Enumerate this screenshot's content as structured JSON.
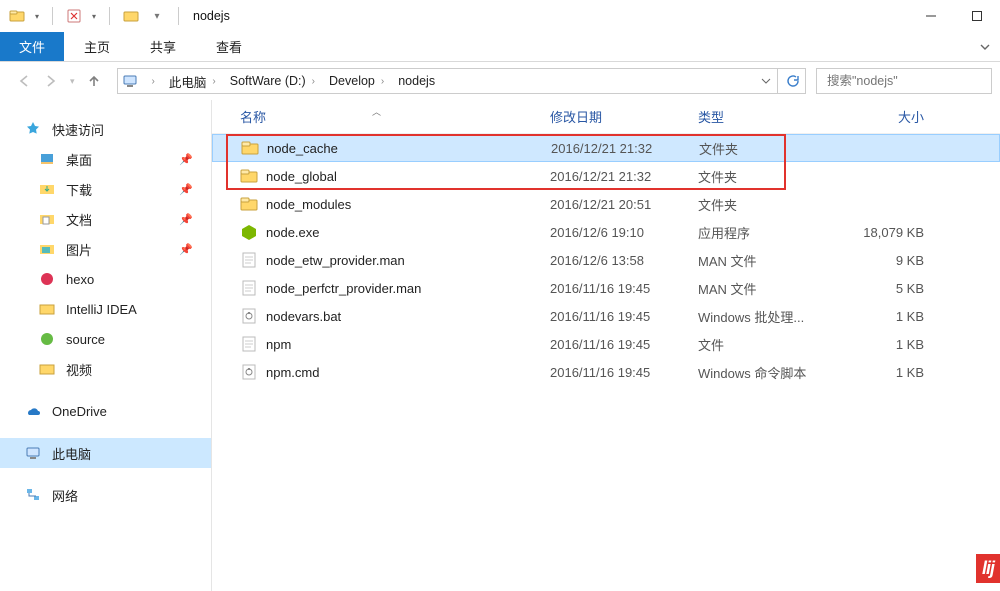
{
  "window": {
    "title": "nodejs"
  },
  "titlebar_qat": {
    "icon1": "folder-icon",
    "icon2": "props-icon"
  },
  "ribbon": {
    "file": "文件",
    "tabs": [
      "主页",
      "共享",
      "查看"
    ]
  },
  "breadcrumbs": [
    "此电脑",
    "SoftWare (D:)",
    "Develop",
    "nodejs"
  ],
  "search": {
    "placeholder": "搜索\"nodejs\""
  },
  "columns": {
    "name": "名称",
    "date": "修改日期",
    "type": "类型",
    "size": "大小"
  },
  "sidebar": {
    "quick_access": "快速访问",
    "quick_items": [
      {
        "label": "桌面",
        "icon": "desktop",
        "pinned": true
      },
      {
        "label": "下载",
        "icon": "download",
        "pinned": true
      },
      {
        "label": "文档",
        "icon": "doc",
        "pinned": true
      },
      {
        "label": "图片",
        "icon": "pic",
        "pinned": true
      },
      {
        "label": "hexo",
        "icon": "hexo",
        "pinned": false
      },
      {
        "label": "IntelliJ IDEA",
        "icon": "folder",
        "pinned": false
      },
      {
        "label": "source",
        "icon": "source",
        "pinned": false
      },
      {
        "label": "视频",
        "icon": "folder",
        "pinned": false
      }
    ],
    "onedrive": "OneDrive",
    "this_pc": "此电脑",
    "network": "网络"
  },
  "files": [
    {
      "name": "node_cache",
      "date": "2016/12/21 21:32",
      "type": "文件夹",
      "size": "",
      "icon": "folder",
      "highlighted": true
    },
    {
      "name": "node_global",
      "date": "2016/12/21 21:32",
      "type": "文件夹",
      "size": "",
      "icon": "folder",
      "highlighted": true
    },
    {
      "name": "node_modules",
      "date": "2016/12/21 20:51",
      "type": "文件夹",
      "size": "",
      "icon": "folder"
    },
    {
      "name": "node.exe",
      "date": "2016/12/6 19:10",
      "type": "应用程序",
      "size": "18,079 KB",
      "icon": "nodeexe"
    },
    {
      "name": "node_etw_provider.man",
      "date": "2016/12/6 13:58",
      "type": "MAN 文件",
      "size": "9 KB",
      "icon": "file"
    },
    {
      "name": "node_perfctr_provider.man",
      "date": "2016/11/16 19:45",
      "type": "MAN 文件",
      "size": "5 KB",
      "icon": "file"
    },
    {
      "name": "nodevars.bat",
      "date": "2016/11/16 19:45",
      "type": "Windows 批处理...",
      "size": "1 KB",
      "icon": "bat"
    },
    {
      "name": "npm",
      "date": "2016/11/16 19:45",
      "type": "文件",
      "size": "1 KB",
      "icon": "file"
    },
    {
      "name": "npm.cmd",
      "date": "2016/11/16 19:45",
      "type": "Windows 命令脚本",
      "size": "1 KB",
      "icon": "bat"
    }
  ],
  "watermark": "lij"
}
